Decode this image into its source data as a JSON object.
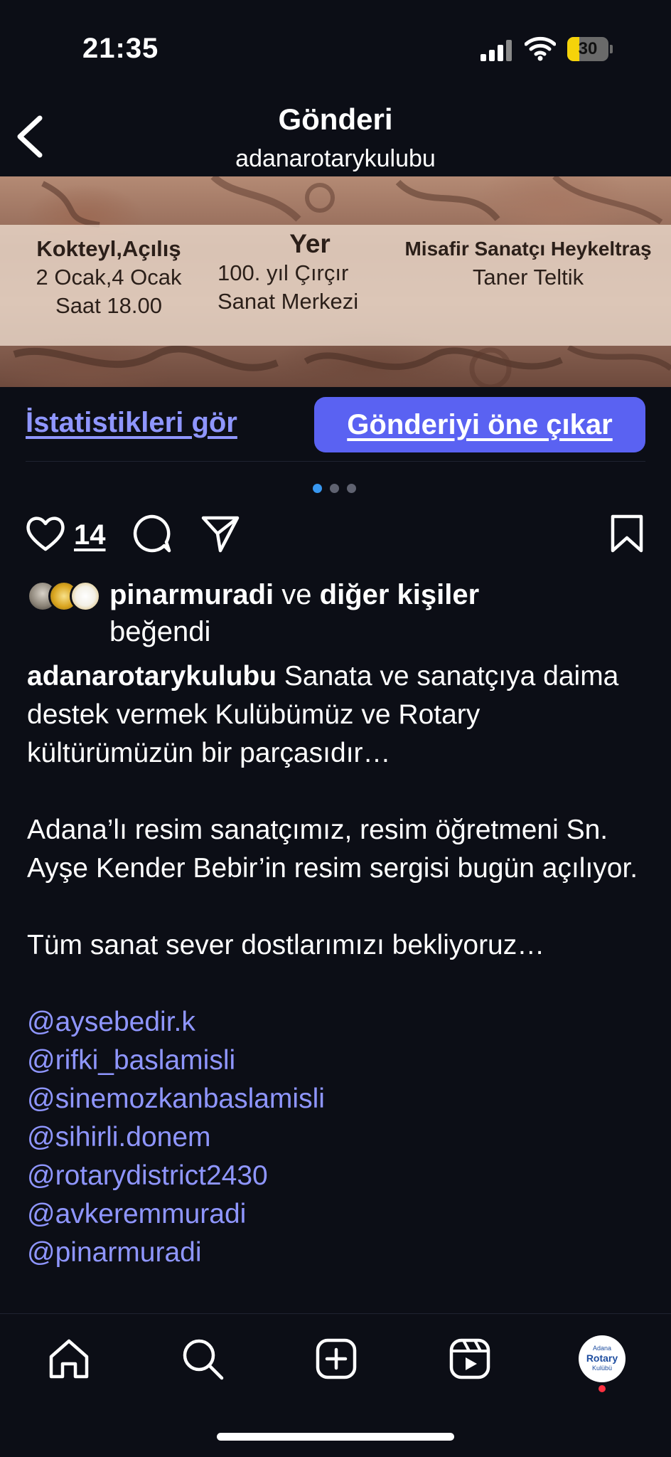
{
  "status": {
    "time": "21:35",
    "battery": "30",
    "battery_level": 0.3
  },
  "header": {
    "title": "Gönderi",
    "subtitle": "adanarotarykulubu"
  },
  "post_image": {
    "col1": {
      "title": "Kokteyl,Açılış",
      "line1": "2 Ocak,4 Ocak",
      "line2": "Saat 18.00"
    },
    "col2": {
      "title": "Yer",
      "line1": "100. yıl Çırçır",
      "line2": "Sanat  Merkezi"
    },
    "col3": {
      "title": "Misafir Sanatçı Heykeltraş",
      "line1": "Taner Teltik"
    }
  },
  "actions": {
    "stats_label": "İstatistikleri gör",
    "boost_label": "Gönderiyi öne çıkar"
  },
  "carousel": {
    "count": 3,
    "active": 0
  },
  "engagement": {
    "like_count": "14"
  },
  "likes": {
    "user": "pinarmuradi",
    "connector": " ve ",
    "others": "diğer kişiler",
    "suffix": "beğendi"
  },
  "caption": {
    "author": "adanarotarykulubu",
    "p1": " Sanata ve sanatçıya daima destek vermek Kulübümüz ve Rotary kültürümüzün bir parçasıdır…",
    "p2": "Adana’lı resim sanatçımız, resim öğretmeni Sn. Ayşe Kender Bebir’in resim sergisi bugün açılıyor.",
    "p3": "Tüm sanat sever dostlarımızı bekliyoruz…",
    "mentions": [
      "@aysebedir.k",
      "@rifki_baslamisli",
      "@sinemozkanbaslamisli",
      "@sihirli.donem",
      "@rotarydistrict2430",
      "@avkeremmuradi",
      "@pinarmuradi"
    ]
  },
  "profile_badge": {
    "line1": "Adana",
    "line2": "Rotary",
    "line3": "Kulübü"
  },
  "colors": {
    "accent": "#5a62f2",
    "link": "#8f96ff",
    "background": "#0c0e16",
    "notification": "#ff3040"
  }
}
